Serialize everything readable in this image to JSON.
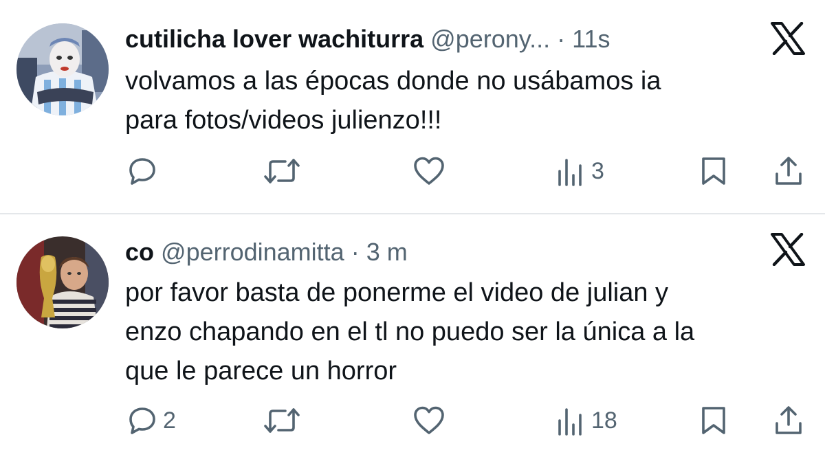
{
  "tweets": [
    {
      "display_name": "cutilicha lover wachiturra",
      "handle": "@perony...",
      "separator": "·",
      "time": "11s",
      "text_lines": [
        "volvamos a las épocas donde no usábamos ia",
        "para fotos/videos julienzo!!!"
      ],
      "reply_count": "",
      "views_count": "3"
    },
    {
      "display_name": "co",
      "handle": "@perrodinamitta",
      "separator": "·",
      "time": "3 m",
      "text_lines": [
        "por favor basta de ponerme el video de julian y",
        "enzo chapando en el tl no puedo ser la única a la",
        "que le parece un horror"
      ],
      "reply_count": "2",
      "views_count": "18"
    }
  ],
  "icons": {
    "reply": "reply-icon",
    "retweet": "retweet-icon",
    "like": "heart-icon",
    "views": "views-icon",
    "bookmark": "bookmark-icon",
    "share": "share-icon",
    "brand": "x-logo-icon"
  },
  "colors": {
    "text": "#0f1419",
    "secondary": "#536471",
    "divider": "#e4e7ea"
  }
}
